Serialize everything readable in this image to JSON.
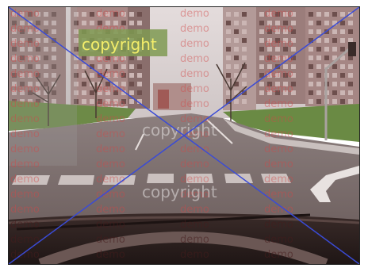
{
  "image": {
    "watermarks": {
      "copyright_label": "copyright",
      "demo_label": "demo"
    },
    "overlay": {
      "type": "crossed-out",
      "line_color": "#3a4bd6"
    },
    "colors": {
      "sky": "#d8d0cf",
      "building": "#9c7e7c",
      "grass": "#6e8a48",
      "road": "#7c6d6c",
      "dashboard": "#2e2220",
      "copyright_box": "#7f9a52",
      "copyright_text": "#f4ee6a"
    }
  }
}
